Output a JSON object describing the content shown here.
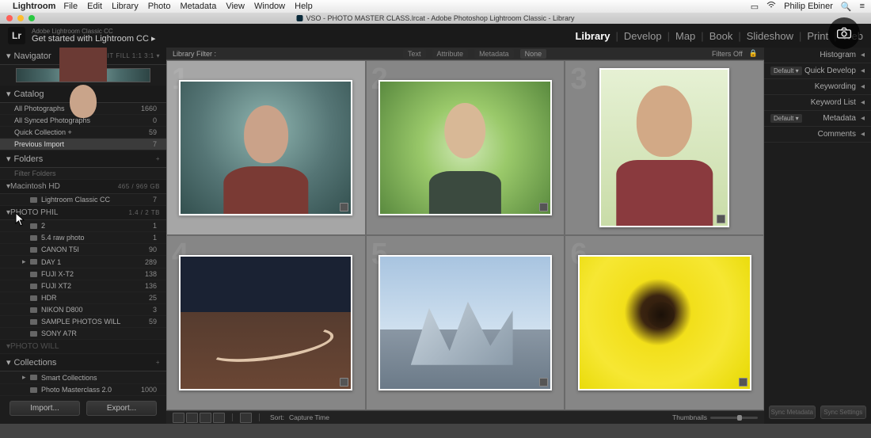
{
  "mac_menu": {
    "app": "Lightroom",
    "items": [
      "File",
      "Edit",
      "Library",
      "Photo",
      "Metadata",
      "View",
      "Window",
      "Help"
    ],
    "user": "Philip Ebiner"
  },
  "window": {
    "title": "VSO - PHOTO MASTER CLASS.lrcat - Adobe Photoshop Lightroom Classic - Library"
  },
  "header": {
    "subtitle": "Adobe Lightroom Classic CC",
    "title": "Get started with Lightroom CC  ▸",
    "logo": "Lr"
  },
  "modules": [
    "Library",
    "Develop",
    "Map",
    "Book",
    "Slideshow",
    "Print",
    "Web"
  ],
  "active_module": "Library",
  "left": {
    "navigator": {
      "label": "Navigator",
      "opts": "FIT   FILL   1:1   3:1  ▾"
    },
    "catalog": {
      "label": "Catalog",
      "rows": [
        {
          "label": "All Photographs",
          "count": "1660"
        },
        {
          "label": "All Synced Photographs",
          "count": "0"
        },
        {
          "label": "Quick Collection  +",
          "count": "59"
        },
        {
          "label": "Previous Import",
          "count": "7",
          "selected": true
        }
      ]
    },
    "folders": {
      "label": "Folders",
      "plus": "+",
      "filter_placeholder": "Filter Folders",
      "volumes": [
        {
          "name": "Macintosh HD",
          "cap": "465 / 969 GB",
          "children": [
            {
              "label": "Lightroom Classic CC",
              "count": "7",
              "icon": true
            }
          ]
        },
        {
          "name": "PHOTO PHIL",
          "cap": "1.4 / 2 TB",
          "children": [
            {
              "label": "2",
              "count": "1",
              "icon": true
            },
            {
              "label": "5.4 raw photo",
              "count": "1",
              "icon": true
            },
            {
              "label": "CANON T5I",
              "count": "90",
              "icon": true
            },
            {
              "label": "DAY 1",
              "count": "289",
              "icon": true,
              "expandable": true
            },
            {
              "label": "FUJI X-T2",
              "count": "138",
              "icon": true
            },
            {
              "label": "FUJI XT2",
              "count": "136",
              "icon": true
            },
            {
              "label": "HDR",
              "count": "25",
              "icon": true
            },
            {
              "label": "NIKON D800",
              "count": "3",
              "icon": true
            },
            {
              "label": "SAMPLE PHOTOS WILL",
              "count": "59",
              "icon": true
            },
            {
              "label": "SONY A7R",
              "count": "",
              "icon": true
            }
          ]
        },
        {
          "name": "PHOTO WILL",
          "cap": "",
          "dim": true
        }
      ]
    },
    "collections": {
      "label": "Collections",
      "rows": [
        {
          "label": "Smart Collections",
          "expandable": true
        },
        {
          "label": "Photo Masterclass 2.0",
          "count": "1000"
        }
      ]
    },
    "buttons": {
      "import": "Import...",
      "export": "Export..."
    }
  },
  "filter_bar": {
    "label": "Library Filter :",
    "tabs": [
      "Text",
      "Attribute",
      "Metadata",
      "None"
    ],
    "active": "None",
    "right": "Filters Off"
  },
  "grid": {
    "cells": [
      {
        "idx": "1",
        "selected": true
      },
      {
        "idx": "2"
      },
      {
        "idx": "3"
      },
      {
        "idx": "4"
      },
      {
        "idx": "5"
      },
      {
        "idx": "6"
      }
    ]
  },
  "toolbar": {
    "sort_label": "Sort:",
    "sort_value": "Capture Time",
    "thumbnails": "Thumbnails"
  },
  "right": {
    "panels": [
      {
        "label": "Histogram"
      },
      {
        "label": "Quick Develop",
        "default": "Default"
      },
      {
        "label": "Keywording"
      },
      {
        "label": "Keyword List"
      },
      {
        "label": "Metadata",
        "default": "Default"
      },
      {
        "label": "Comments"
      }
    ],
    "buttons": {
      "sync_meta": "Sync Metadata",
      "sync_settings": "Sync Settings"
    }
  }
}
